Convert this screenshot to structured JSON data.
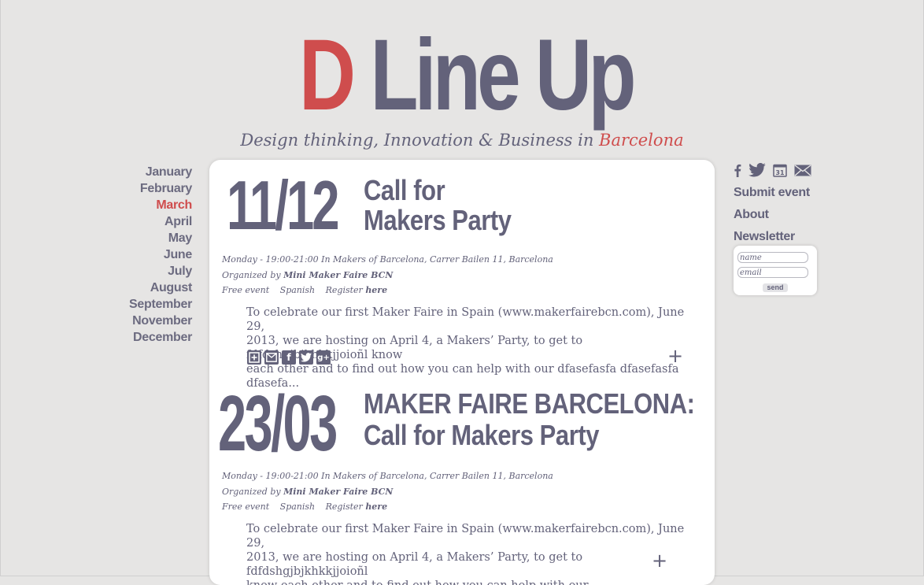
{
  "header": {
    "logo_initial": "D",
    "logo_rest": " Line Up",
    "tagline_main": "Design thinking, Innovation & Business in ",
    "tagline_city": "Barcelona"
  },
  "months": [
    "January",
    "February",
    "March",
    "April",
    "May",
    "June",
    "July",
    "August",
    "September",
    "November",
    "December"
  ],
  "active_month": "March",
  "events": [
    {
      "date": "11/12",
      "title_line1": "Call for",
      "title_line2": "Makers Party",
      "when_where": "Monday - 19:00-21:00 In Makers of Barcelona, Carrer Bailen 11, Barcelona",
      "organized_prefix": "Organized by ",
      "organizer": "Mini Maker Faire BCN",
      "price": "Free event",
      "language": "Spanish",
      "register_prefix": "Register ",
      "register_link": "here",
      "description_lines": [
        "To celebrate our first Maker Faire in Spain (www.makerfairebcn.com), June 29,",
        "2013, we are hosting on April 4, a Makers’ Party, to get to fdfdshgjbjkhkkjjoioñl know",
        "each other and to find out how you can help with our dfasefasfa dfasefasfa dfasefa..."
      ]
    },
    {
      "date": "23/03",
      "title_line1": "MAKER FAIRE BARCELONA:",
      "title_line2": "Call for Makers Party",
      "when_where": "Monday - 19:00-21:00 In Makers of Barcelona, Carrer Bailen 11, Barcelona",
      "organized_prefix": "Organized by ",
      "organizer": "Mini Maker Faire BCN",
      "price": "Free event",
      "language": "Spanish",
      "register_prefix": "Register ",
      "register_link": "here",
      "description_lines": [
        "To celebrate our first Maker Faire in Spain (www.makerfairebcn.com), June 29,",
        "2013, we are hosting on April 4, a Makers’ Party, to get to fdfdshgjbjkhkkjjoioñl",
        "know each other and to find out how you can help with our dfasefasfadadfadfd..."
      ]
    }
  ],
  "share_icons": [
    "add-calendar-icon",
    "email-icon",
    "facebook-icon",
    "twitter-icon",
    "google-plus-icon"
  ],
  "expand_symbol": "+",
  "sidebar_right": {
    "social_icons": [
      "facebook-icon",
      "twitter-icon",
      "calendar-icon",
      "email-icon"
    ],
    "calendar_day": "31",
    "links": [
      "Submit event",
      "About",
      "Newsletter"
    ],
    "newsletter": {
      "name_placeholder": "name",
      "email_placeholder": "email",
      "send_label": "send"
    }
  },
  "colors": {
    "accent": "#cf4d4d",
    "text": "#63627a",
    "background": "#e6e5e4",
    "panel": "#ffffff"
  }
}
